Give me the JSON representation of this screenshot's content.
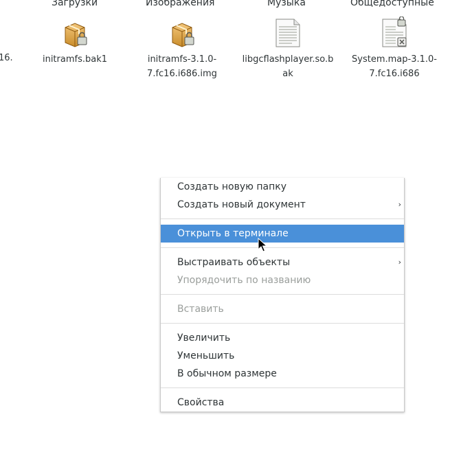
{
  "column_headers": [
    "Загрузки",
    "Изображения",
    "Музыка",
    "Общедоступные"
  ],
  "cut_label": "16.",
  "files": [
    {
      "name": "initramfs.bak1",
      "icon": "package-lock-icon"
    },
    {
      "name": "initramfs-3.1.0-7.fc16.i686.img",
      "icon": "package-lock-icon"
    },
    {
      "name": "libgcflashplayer.so.bak",
      "icon": "text-document-icon"
    },
    {
      "name": "System.map-3.1.0-7.fc16.i686",
      "icon": "text-document-lock-x-icon"
    }
  ],
  "context_menu": {
    "create_folder": "Создать новую папку",
    "create_document": "Создать новый документ",
    "open_terminal": "Открыть в терминале",
    "arrange_items": "Выстраивать объекты",
    "sort_by_name": "Упорядочить по названию",
    "paste": "Вставить",
    "zoom_in": "Увеличить",
    "zoom_out": "Уменьшить",
    "normal_size": "В обычном размере",
    "properties": "Свойства",
    "submenu_arrow": "›"
  }
}
